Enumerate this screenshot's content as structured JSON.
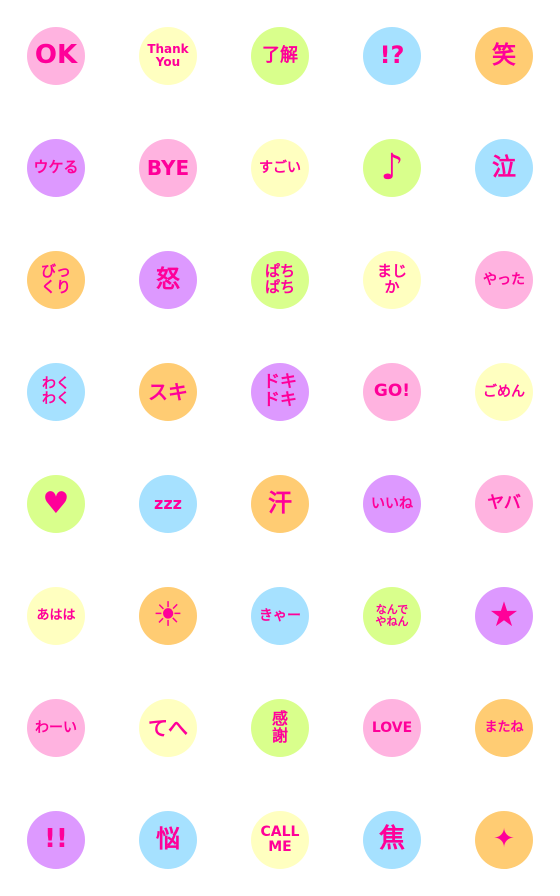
{
  "text_color": "#ff0099",
  "palette": {
    "pink": "#ffb3e0",
    "yellow": "#ffffc0",
    "green": "#d9ff8c",
    "blue": "#a6e1ff",
    "orange": "#ffcc73",
    "purple": "#dd99ff"
  },
  "stickers": [
    {
      "label": "OK",
      "color": "pink",
      "size": 26
    },
    {
      "label": "Thank\nYou",
      "color": "yellow",
      "size": 12
    },
    {
      "label": "了解",
      "color": "green",
      "size": 18
    },
    {
      "label": "!?",
      "color": "blue",
      "size": 24,
      "icon": "exclaim-question-stars"
    },
    {
      "label": "笑",
      "color": "orange",
      "size": 24
    },
    {
      "label": "ウケる",
      "color": "purple",
      "size": 15
    },
    {
      "label": "BYE",
      "color": "pink",
      "size": 20
    },
    {
      "label": "すごい",
      "color": "yellow",
      "size": 14
    },
    {
      "label": "♪",
      "color": "green",
      "size": 36,
      "icon": "music-note-icon"
    },
    {
      "label": "泣",
      "color": "blue",
      "size": 24
    },
    {
      "label": "びっ\nくり",
      "color": "orange",
      "size": 15
    },
    {
      "label": "怒",
      "color": "purple",
      "size": 24
    },
    {
      "label": "ぱち\nぱち",
      "color": "green",
      "size": 15
    },
    {
      "label": "まじ\nか",
      "color": "yellow",
      "size": 15
    },
    {
      "label": "やった",
      "color": "pink",
      "size": 14
    },
    {
      "label": "わく\nわく",
      "color": "blue",
      "size": 14
    },
    {
      "label": "スキ",
      "color": "orange",
      "size": 20
    },
    {
      "label": "ドキ\nドキ",
      "color": "purple",
      "size": 17
    },
    {
      "label": "GO!",
      "color": "pink",
      "size": 17
    },
    {
      "label": "ごめん",
      "color": "yellow",
      "size": 14
    },
    {
      "label": "♥",
      "color": "green",
      "size": 30,
      "icon": "heart-icon"
    },
    {
      "label": "zzz",
      "color": "blue",
      "size": 16
    },
    {
      "label": "汗",
      "color": "orange",
      "size": 24
    },
    {
      "label": "いいね",
      "color": "purple",
      "size": 14
    },
    {
      "label": "ヤバ",
      "color": "pink",
      "size": 17
    },
    {
      "label": "あはは",
      "color": "yellow",
      "size": 13
    },
    {
      "label": "☀",
      "color": "orange",
      "size": 34,
      "icon": "sun-icon"
    },
    {
      "label": "きゃー",
      "color": "blue",
      "size": 14
    },
    {
      "label": "なんで\nやねん",
      "color": "green",
      "size": 11
    },
    {
      "label": "★",
      "color": "purple",
      "size": 34,
      "icon": "star-icon"
    },
    {
      "label": "わーい",
      "color": "pink",
      "size": 14
    },
    {
      "label": "てへ",
      "color": "yellow",
      "size": 20
    },
    {
      "label": "感\n謝",
      "color": "green",
      "size": 16
    },
    {
      "label": "LOVE",
      "color": "pink",
      "size": 14
    },
    {
      "label": "またね",
      "color": "orange",
      "size": 13
    },
    {
      "label": "!!",
      "color": "purple",
      "size": 26
    },
    {
      "label": "悩",
      "color": "blue",
      "size": 24
    },
    {
      "label": "CALL\nME",
      "color": "yellow",
      "size": 14
    },
    {
      "label": "焦",
      "color": "blue",
      "size": 26
    },
    {
      "label": "✦",
      "color": "orange",
      "size": 26,
      "icon": "sparkle-icon"
    }
  ]
}
